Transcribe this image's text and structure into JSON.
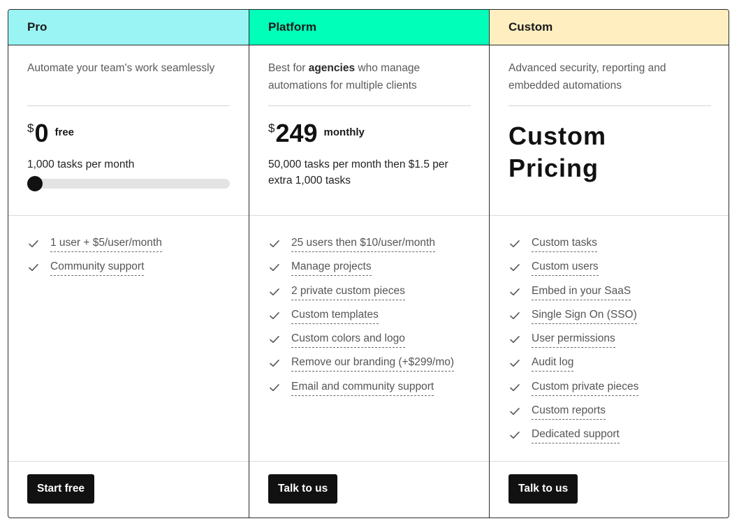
{
  "plans": [
    {
      "name": "Pro",
      "header_color": "#9BF4F4",
      "desc_before": "Automate your team's work seamlessly",
      "desc_bold": "",
      "desc_after": "",
      "currency": "$",
      "price": "0",
      "period": "free",
      "custom_price": "",
      "tasks": "1,000 tasks per month",
      "slider_value": 0,
      "features": [
        "1 user + $5/user/month",
        "Community support"
      ],
      "cta": "Start free"
    },
    {
      "name": "Platform",
      "header_color": "#00FFB9",
      "desc_before": "Best for ",
      "desc_bold": "agencies",
      "desc_after": " who manage automations for multiple clients",
      "currency": "$",
      "price": "249",
      "period": "monthly",
      "custom_price": "",
      "tasks": "50,000 tasks per month then $1.5 per extra 1,000 tasks",
      "features": [
        "25 users then $10/user/month",
        "Manage projects",
        "2 private custom pieces",
        "Custom templates",
        "Custom colors and logo",
        "Remove our branding (+$299/mo)",
        "Email and community support"
      ],
      "cta": "Talk to us"
    },
    {
      "name": "Custom",
      "header_color": "#FFEFC0",
      "desc_before": "Advanced security, reporting and embedded automations",
      "desc_bold": "",
      "desc_after": "",
      "currency": "",
      "price": "",
      "period": "",
      "custom_price": "Custom Pricing",
      "tasks": "",
      "features": [
        "Custom tasks",
        "Custom users",
        "Embed in your SaaS",
        "Single Sign On (SSO)",
        "User permissions",
        "Audit log",
        "Custom private pieces",
        "Custom reports",
        "Dedicated support"
      ],
      "cta": "Talk to us"
    }
  ],
  "icons": {
    "feature_check": "check-icon"
  }
}
